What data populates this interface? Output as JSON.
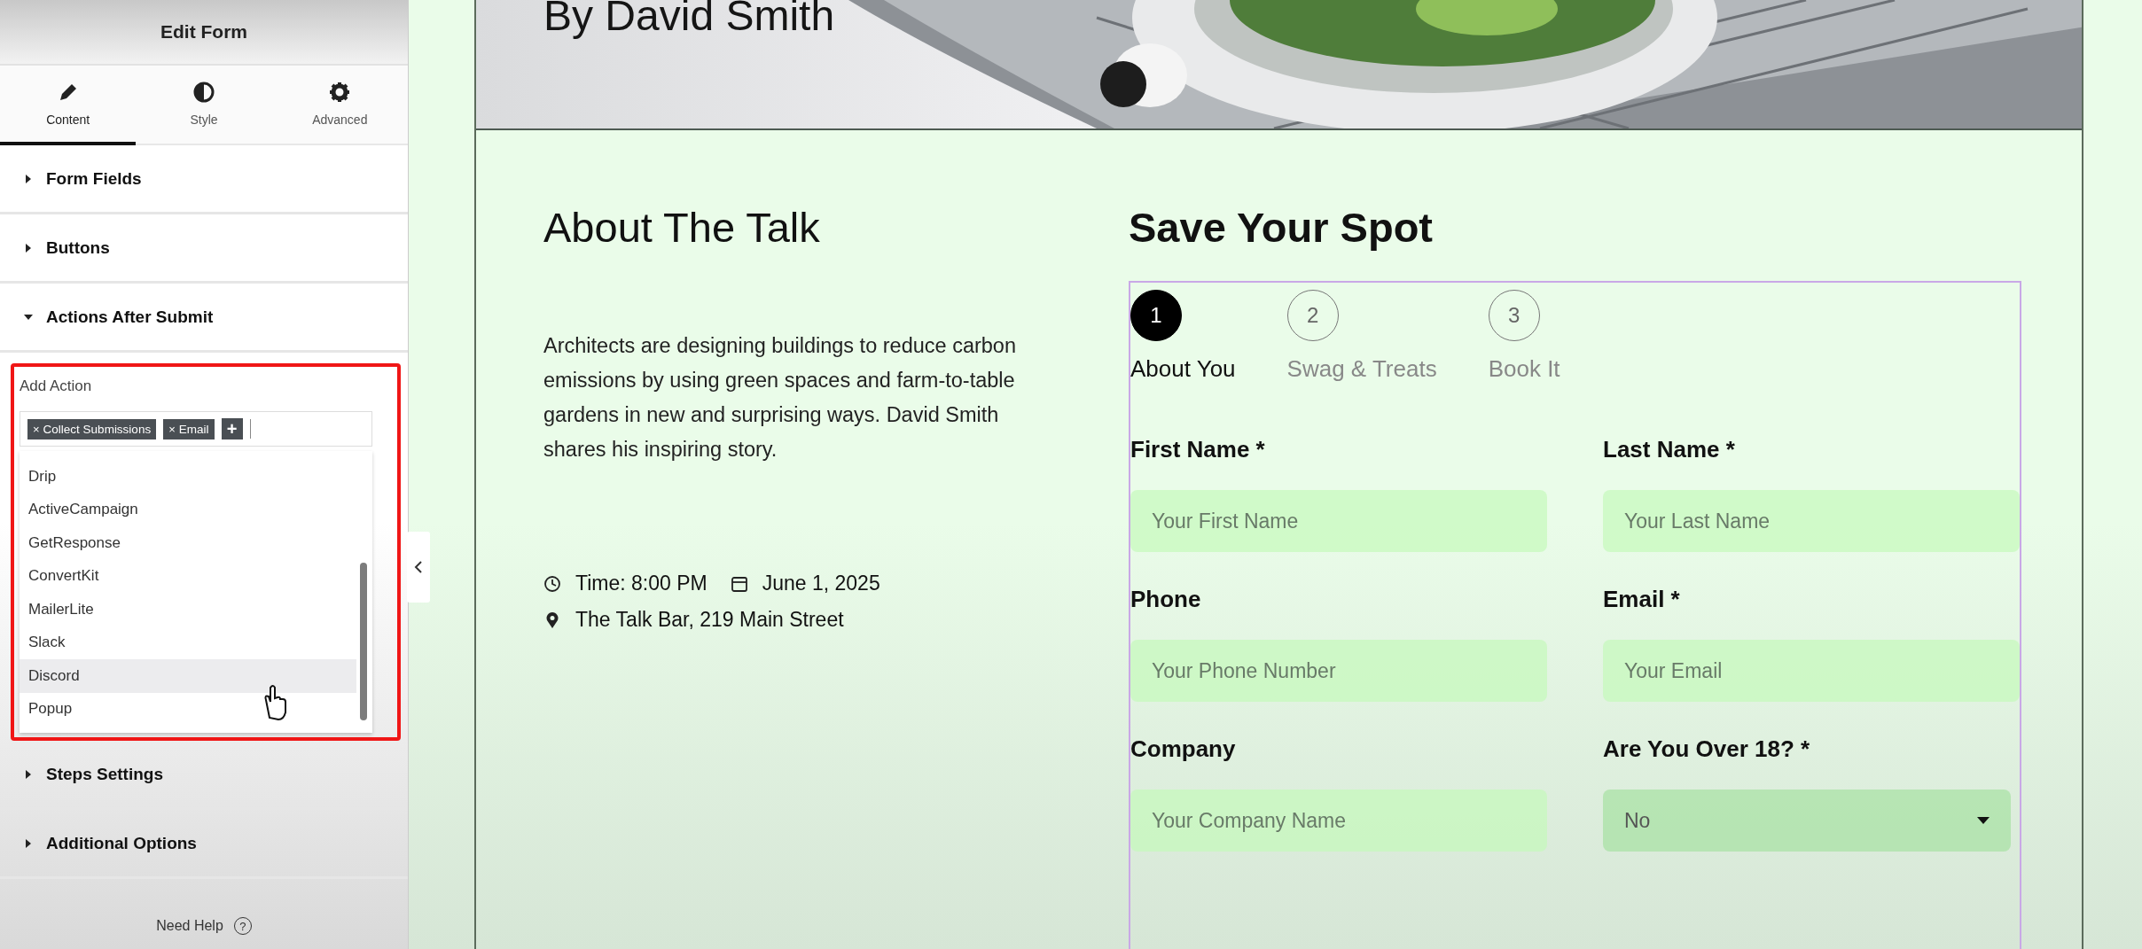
{
  "panel": {
    "title": "Edit Form",
    "tabs": [
      {
        "label": "Content",
        "selected": true
      },
      {
        "label": "Style",
        "selected": false
      },
      {
        "label": "Advanced",
        "selected": false
      }
    ],
    "sections_before": [
      {
        "label": "Form Fields",
        "expanded": false
      },
      {
        "label": "Buttons",
        "expanded": false
      },
      {
        "label": "Actions After Submit",
        "expanded": true
      }
    ],
    "add_action": {
      "label": "Add Action",
      "remove_mark": "×",
      "tags": [
        "Collect Submissions",
        "Email"
      ],
      "add_button": "+",
      "options": [
        {
          "label": "Drip",
          "hovered": false
        },
        {
          "label": "ActiveCampaign",
          "hovered": false
        },
        {
          "label": "GetResponse",
          "hovered": false
        },
        {
          "label": "ConvertKit",
          "hovered": false
        },
        {
          "label": "MailerLite",
          "hovered": false
        },
        {
          "label": "Slack",
          "hovered": false
        },
        {
          "label": "Discord",
          "hovered": true
        },
        {
          "label": "Popup",
          "hovered": false
        }
      ]
    },
    "sections_after": [
      {
        "label": "Steps Settings",
        "expanded": false
      },
      {
        "label": "Additional Options",
        "expanded": false
      }
    ],
    "help": "Need Help",
    "help_icon": "?"
  },
  "page": {
    "hero_title": "By David Smith",
    "about": {
      "title": "About The Talk",
      "text": "Architects are designing buildings to reduce carbon emissions by using green spaces and farm-to-table gardens in new and surprising ways. David Smith shares his inspiring story.",
      "time": "Time: 8:00 PM",
      "date": "June 1, 2025",
      "location": "The Talk Bar, 219 Main Street"
    },
    "form": {
      "title": "Save Your Spot",
      "steps": [
        {
          "number": "1",
          "label": "About You",
          "selected": true
        },
        {
          "number": "2",
          "label": "Swag & Treats",
          "selected": false
        },
        {
          "number": "3",
          "label": "Book It",
          "selected": false
        }
      ],
      "fields": [
        {
          "kind": "text",
          "label": "First Name *",
          "placeholder": "Your First Name"
        },
        {
          "kind": "text",
          "label": "Last Name *",
          "placeholder": "Your Last Name"
        },
        {
          "kind": "text",
          "label": "Phone",
          "placeholder": "Your Phone Number"
        },
        {
          "kind": "text",
          "label": "Email *",
          "placeholder": "Your Email"
        },
        {
          "kind": "text",
          "label": "Company",
          "placeholder": "Your Company Name"
        },
        {
          "kind": "select",
          "label": "Are You Over 18? *",
          "value": "No"
        }
      ]
    }
  }
}
